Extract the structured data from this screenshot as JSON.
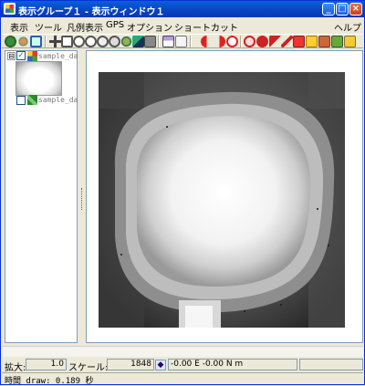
{
  "window": {
    "title": "表示グループ１ - 表示ウィンドウ１",
    "min_glyph": "_",
    "max_glyph": "□",
    "close_glyph": "×"
  },
  "menubar": {
    "items": [
      "表示",
      "ツール",
      "凡例表示",
      "GPS",
      "オプション",
      "ショートカット"
    ],
    "help": "ヘルプ"
  },
  "toolbar": {
    "icons": [
      "home-icon",
      "refresh-icon",
      "zoom-box-icon",
      "pan-icon",
      "zoom-full-icon",
      "zoom-in-icon",
      "zoom-out-icon",
      "zoom-layer-icon",
      "zoom-prev-icon",
      "locate-icon",
      "select-icon",
      "measure-icon",
      "back-icon",
      "forward-icon",
      "stop-icon",
      "search-icon",
      "target-icon",
      "pointer-icon",
      "edit-icon",
      "print-icon",
      "save-icon",
      "export-icon",
      "tools-icon"
    ]
  },
  "legend": {
    "group_expand": "⊟",
    "layer1_label": "sample_da",
    "layer2_label": "sample_da",
    "check_glyph": "✓",
    "layer1_checked": true,
    "layer2_checked": false
  },
  "status": {
    "zoom_label": "拡大:",
    "zoom_value": "1.0",
    "scale_label": "スケール:",
    "scale_value": "1848",
    "coords": "-0.00 E  -0.00 N m",
    "draw_time": "時間 draw: 0.189 秒"
  },
  "colors": {
    "titlebar": "#0843c2",
    "accent": "#0831d9",
    "close_button": "#c8401c"
  }
}
